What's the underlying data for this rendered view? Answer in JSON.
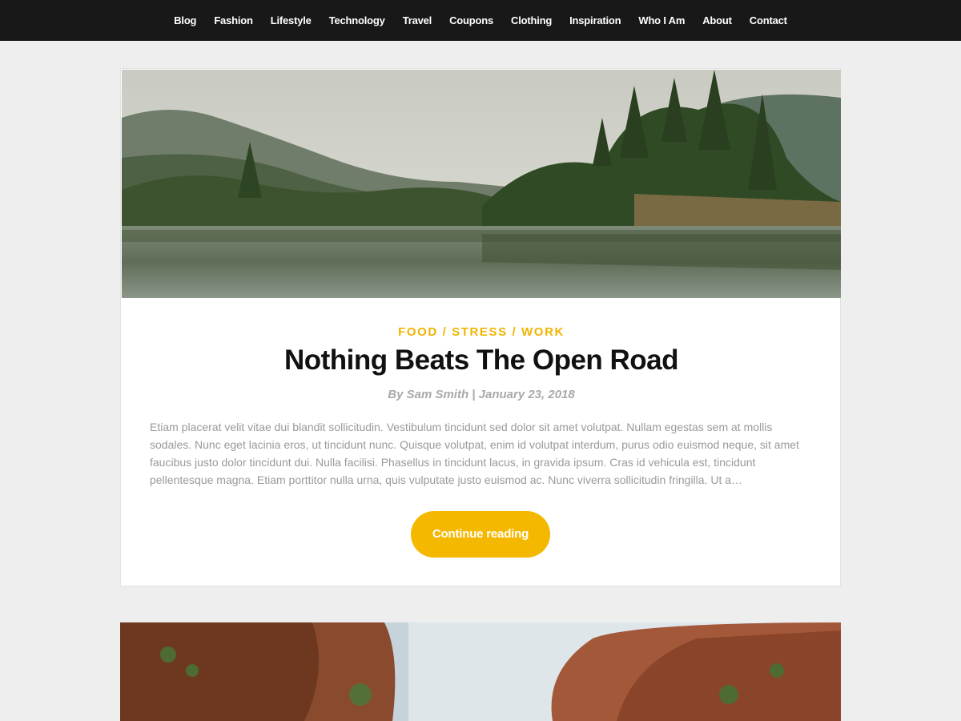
{
  "nav": {
    "items": [
      {
        "label": "Blog"
      },
      {
        "label": "Fashion"
      },
      {
        "label": "Lifestyle"
      },
      {
        "label": "Technology"
      },
      {
        "label": "Travel"
      },
      {
        "label": "Coupons"
      },
      {
        "label": "Clothing"
      },
      {
        "label": "Inspiration"
      },
      {
        "label": "Who I Am"
      },
      {
        "label": "About"
      },
      {
        "label": "Contact"
      }
    ]
  },
  "post": {
    "categories": [
      "FOOD",
      "STRESS",
      "WORK"
    ],
    "category_separator": " / ",
    "title": "Nothing Beats The Open Road",
    "meta": "By Sam Smith | January 23, 2018",
    "excerpt": "Etiam placerat velit vitae dui blandit sollicitudin. Vestibulum tincidunt sed dolor sit amet volutpat. Nullam egestas sem at mollis sodales. Nunc eget lacinia eros, ut tincidunt nunc. Quisque volutpat, enim id volutpat interdum, purus odio euismod neque, sit amet faucibus justo dolor tincidunt dui. Nulla facilisi. Phasellus in tincidunt lacus, in gravida ipsum. Cras id vehicula est, tincidunt pellentesque magna. Etiam porttitor nulla urna, quis vulputate justo euismod ac. Nunc viverra sollicitudin fringilla. Ut a…",
    "button_label": "Continue reading"
  },
  "colors": {
    "accent": "#f5b800",
    "nav_bg": "#181818",
    "page_bg": "#eeeeee"
  }
}
